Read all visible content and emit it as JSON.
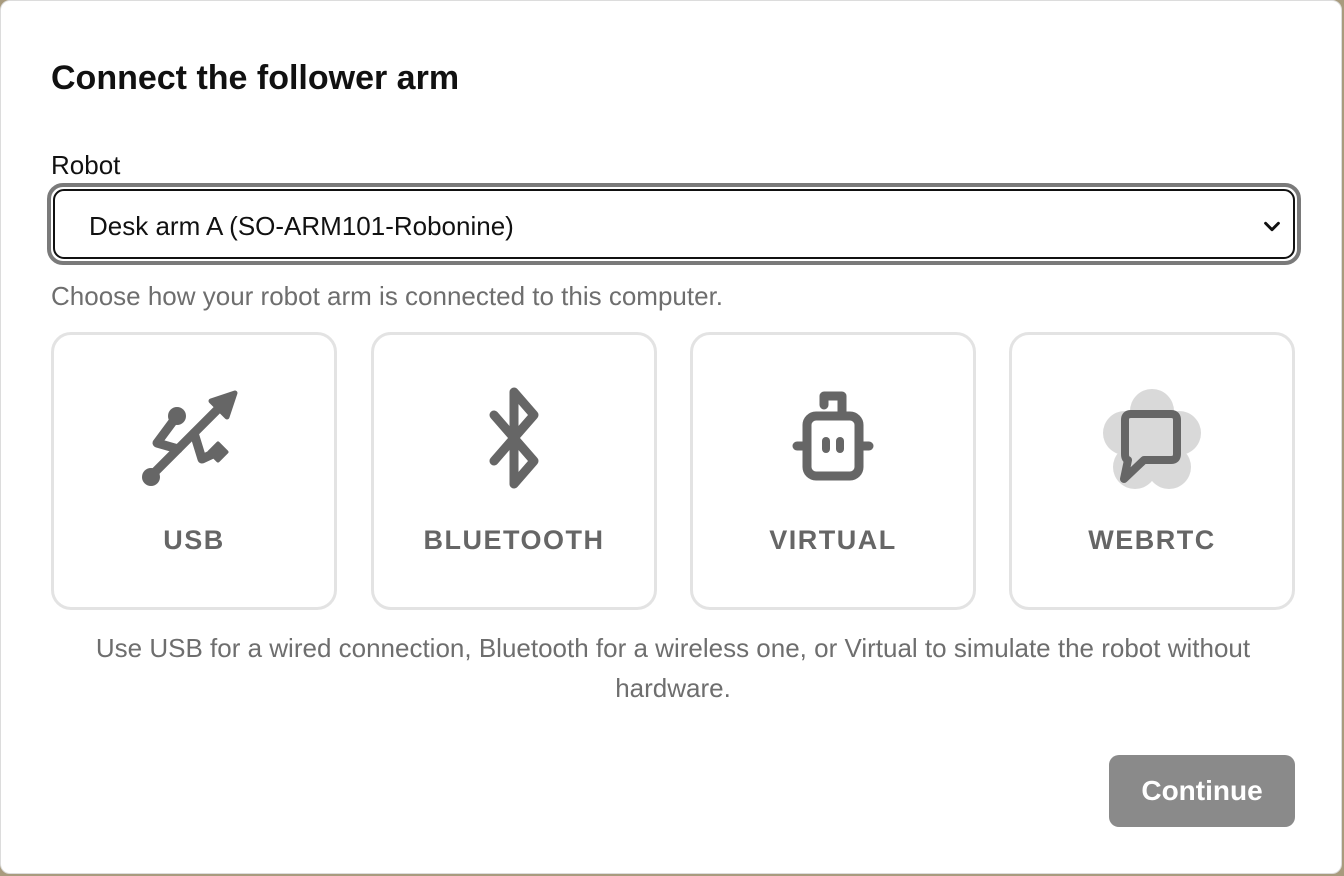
{
  "dialog": {
    "title": "Connect the follower arm",
    "robot_label": "Robot",
    "robot_select": {
      "selected": "Desk arm A (SO-ARM101-Robonine)"
    },
    "helper_text": "Choose how your robot arm is connected to this computer.",
    "options": [
      {
        "label": "USB",
        "icon": "usb-icon"
      },
      {
        "label": "BLUETOOTH",
        "icon": "bluetooth-icon"
      },
      {
        "label": "VIRTUAL",
        "icon": "robot-icon"
      },
      {
        "label": "WEBRTC",
        "icon": "chat-bubble-icon"
      }
    ],
    "note": "Use USB for a wired connection, Bluetooth for a wireless one, or Virtual to simulate the robot without hardware.",
    "continue_label": "Continue"
  },
  "colors": {
    "icon": "#666666",
    "option_border": "#e3e3e3",
    "button_disabled": "#8a8a8a",
    "muted_text": "#6e6e6e"
  }
}
